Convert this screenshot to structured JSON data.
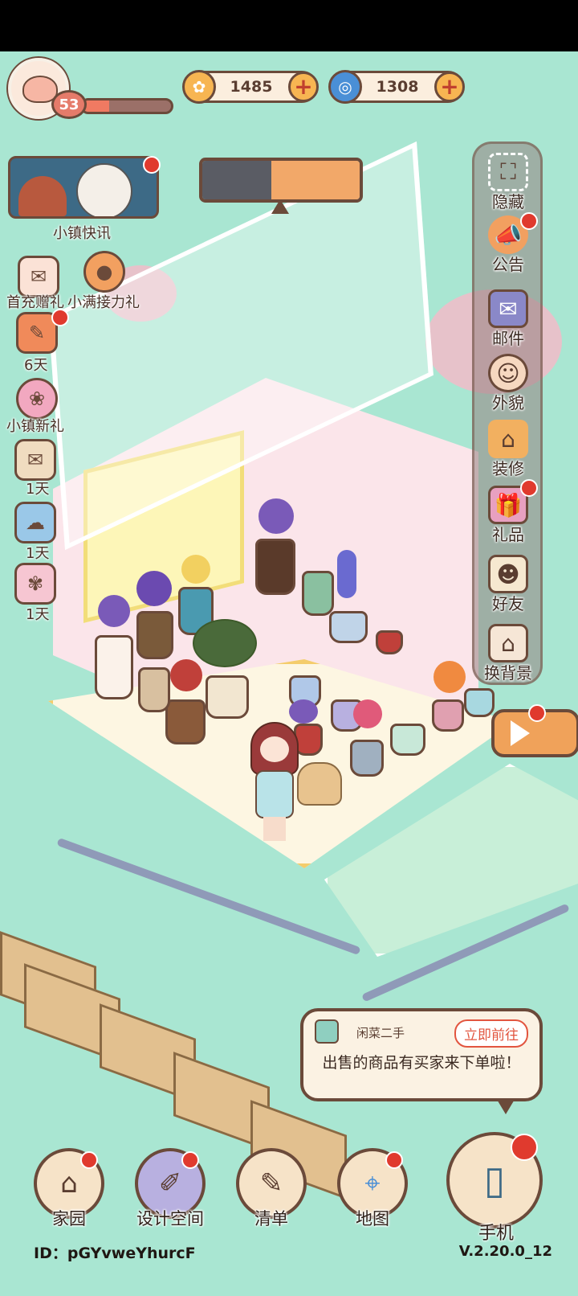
{
  "hud": {
    "level": "53",
    "xp_fraction": 0.3,
    "coins": "1485",
    "gems": "1308",
    "coin_color": "#f7b552",
    "gem_color": "#4a8fd6"
  },
  "left_menu": {
    "news_label": "小镇快讯",
    "first_recharge_label": "首充赠礼",
    "relay_gift_label": "小满接力礼",
    "timer_1": "6天",
    "town_gift_label": "小镇新礼",
    "timer_2": "1天",
    "timer_3": "1天",
    "timer_4": "1天"
  },
  "right_menu": {
    "items": [
      {
        "label": "隐藏",
        "icon": "expand-icon"
      },
      {
        "label": "公告",
        "icon": "megaphone-icon"
      },
      {
        "label": "邮件",
        "icon": "mail-icon"
      },
      {
        "label": "外貌",
        "icon": "avatar-icon"
      },
      {
        "label": "装修",
        "icon": "house-tool-icon"
      },
      {
        "label": "礼品",
        "icon": "gift-icon"
      },
      {
        "label": "好友",
        "icon": "friends-book-icon"
      },
      {
        "label": "换背景",
        "icon": "background-icon"
      }
    ]
  },
  "notice": {
    "app": "闲菜二手",
    "go_label": "立即前往",
    "message": "出售的商品有买家来下单啦！"
  },
  "dock": {
    "home": "家园",
    "design": "设计空间",
    "list": "清单",
    "map": "地图",
    "phone": "手机"
  },
  "footer": {
    "player_id": "ID：pGYvweYhurcF",
    "version": "V.2.20.0_12"
  },
  "colors": {
    "background": "#a9e6d2",
    "outline": "#6b4a3a",
    "badge_red": "#e03a2e"
  }
}
